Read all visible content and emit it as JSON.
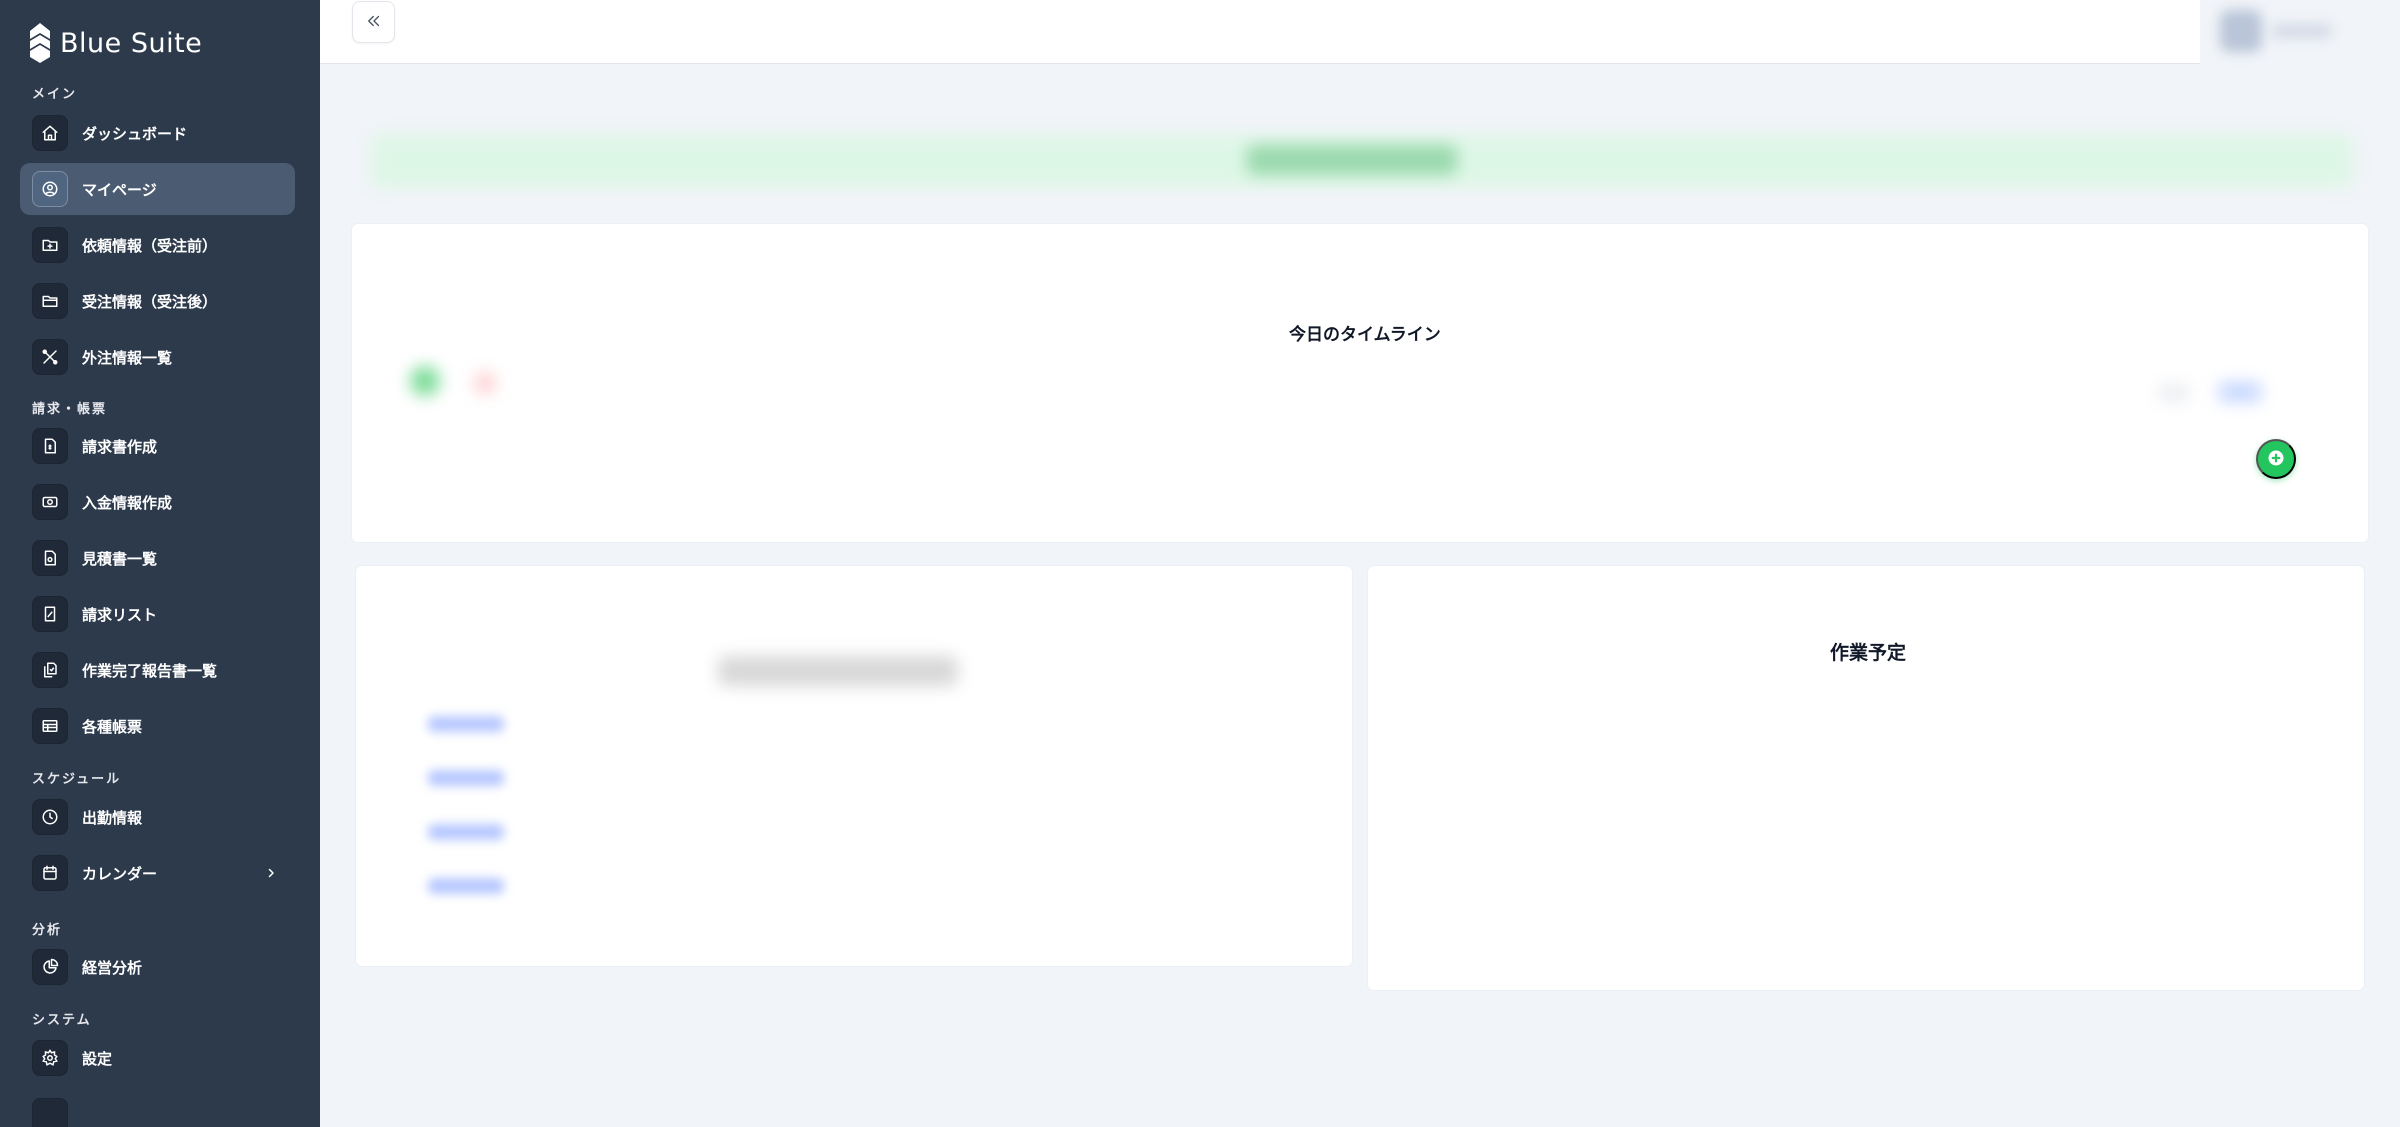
{
  "brand": {
    "name": "Blue Suite"
  },
  "sections": {
    "main": "メイン",
    "billing": "請求・帳票",
    "schedule": "スケジュール",
    "analysis": "分析",
    "system": "システム"
  },
  "nav": {
    "dashboard": "ダッシュボード",
    "mypage": "マイページ",
    "requests_before": "依頼情報（受注前）",
    "orders_after": "受注情報（受注後）",
    "outsourcing": "外注情報一覧",
    "invoice_create": "請求書作成",
    "payment_create": "入金情報作成",
    "estimates": "見積書一覧",
    "billing_list": "請求リスト",
    "completion_reports": "作業完了報告書一覧",
    "forms": "各種帳票",
    "attendance": "出勤情報",
    "calendar": "カレンダー",
    "management_analysis": "経営分析",
    "settings": "設定"
  },
  "icons": {
    "dashboard": "home-icon",
    "mypage": "user-circle-icon",
    "requests_before": "folder-plus-icon",
    "orders_after": "folder-icon",
    "outsourcing": "tools-icon",
    "invoice_create": "invoice-icon",
    "payment_create": "cash-icon",
    "estimates": "document-icon",
    "billing_list": "list-document-icon",
    "completion_reports": "files-icon",
    "forms": "table-icon",
    "attendance": "clock-icon",
    "calendar": "calendar-icon",
    "management_analysis": "pie-chart-icon",
    "settings": "gear-icon"
  },
  "main": {
    "timeline_title": "今日のタイムライン",
    "schedule_title": "作業予定"
  },
  "colors": {
    "sidebar_bg": "#2d3a4c",
    "sidebar_active": "#4a5b72",
    "page_bg": "#f1f4f8",
    "accent_green": "#22c55e"
  }
}
